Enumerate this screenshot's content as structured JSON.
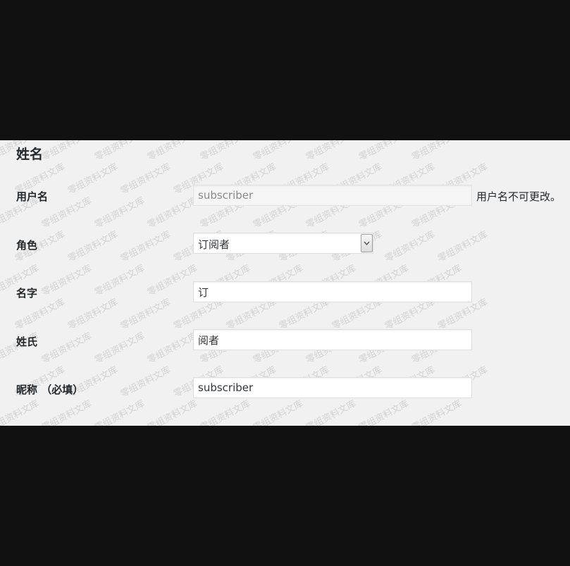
{
  "section": {
    "title": "姓名"
  },
  "hint": {
    "username_note": "用户名不可更改。"
  },
  "fields": {
    "username": {
      "label": "用户名",
      "value": "subscriber"
    },
    "role": {
      "label": "角色",
      "selected": "订阅者"
    },
    "first_name": {
      "label": "名字",
      "value": "订"
    },
    "last_name": {
      "label": "姓氏",
      "value": "阅者"
    },
    "nickname": {
      "label": "昵称 （必填）",
      "value": "subscriber"
    }
  },
  "watermark": {
    "text": "零组资料文库"
  },
  "colors": {
    "panel_bg": "#f1f1f1",
    "letterbox": "#111111",
    "label_text": "#23282d",
    "input_border": "#dddddd"
  },
  "icons": {
    "role_dropdown": "chevron-down-icon"
  }
}
